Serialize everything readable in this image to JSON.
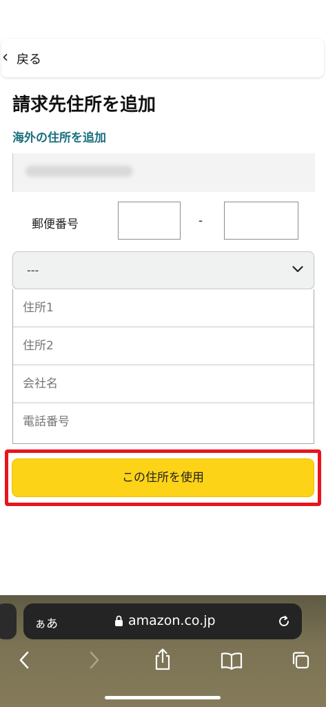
{
  "back": {
    "label": "戻る"
  },
  "page": {
    "title": "請求先住所を追加",
    "intl_link": "海外の住所を追加"
  },
  "form": {
    "zip_label": "郵便番号",
    "zip_separator": "-",
    "prefecture_value": "---",
    "address1_placeholder": "住所1",
    "address2_placeholder": "住所2",
    "company_placeholder": "会社名",
    "phone_placeholder": "電話番号",
    "submit_label": "この住所を使用"
  },
  "browser": {
    "text_size_label": "ぁあ",
    "domain": "amazon.co.jp"
  },
  "colors": {
    "button_yellow": "#fcd317",
    "highlight_red": "#e8141c",
    "link_teal": "#1b6f7e"
  }
}
